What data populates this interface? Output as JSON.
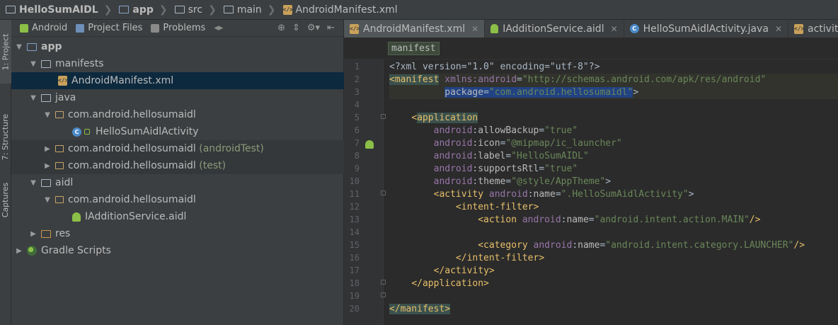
{
  "breadcrumb": [
    {
      "label": "HelloSumAIDL",
      "bold": true
    },
    {
      "label": "app",
      "bold": true
    },
    {
      "label": "src",
      "bold": false
    },
    {
      "label": "main",
      "bold": false
    },
    {
      "label": "AndroidManifest.xml",
      "bold": false
    }
  ],
  "toolstrip": {
    "project_tab": "1: Project",
    "structure_tab": "7: Structure",
    "captures_tab": "Captures"
  },
  "project_toolbar": {
    "android": "Android",
    "project_files": "Project Files",
    "problems": "Problems"
  },
  "tree": [
    {
      "label": "app",
      "suffix": ""
    },
    {
      "label": "manifests",
      "suffix": ""
    },
    {
      "label": "AndroidManifest.xml",
      "suffix": ""
    },
    {
      "label": "java",
      "suffix": ""
    },
    {
      "label": "com.android.hellosumaidl",
      "suffix": ""
    },
    {
      "label": "HelloSumAidlActivity",
      "suffix": ""
    },
    {
      "label": "com.android.hellosumaidl",
      "suffix": "(androidTest)"
    },
    {
      "label": "com.android.hellosumaidl",
      "suffix": "(test)"
    },
    {
      "label": "aidl",
      "suffix": ""
    },
    {
      "label": "com.android.hellosumaidl",
      "suffix": ""
    },
    {
      "label": "IAdditionService.aidl",
      "suffix": ""
    },
    {
      "label": "res",
      "suffix": ""
    },
    {
      "label": "Gradle Scripts",
      "suffix": ""
    }
  ],
  "editor_tabs": [
    {
      "label": "AndroidManifest.xml",
      "active": true
    },
    {
      "label": "IAdditionService.aidl",
      "active": false
    },
    {
      "label": "HelloSumAidlActivity.java",
      "active": false
    },
    {
      "label": "activity_hello",
      "active": false
    }
  ],
  "xml_breadcrumb": "manifest",
  "code": {
    "line_numbers": [
      "1",
      "2",
      "3",
      "4",
      "5",
      "6",
      "7",
      "8",
      "9",
      "10",
      "11",
      "12",
      "13",
      "14",
      "15",
      "16",
      "17",
      "18",
      "19",
      "20"
    ],
    "l1": "<?xml version=\"1.0\" encoding=\"utf-8\"?>",
    "l2_tag": "<manifest",
    "l2_ns": "xmlns:android",
    "l2_val": "\"http://schemas.android.com/apk/res/android\"",
    "l3_attr": "package",
    "l3_val": "\"com.android.hellosumaidl\"",
    "l5_tag": "application",
    "l6_attr": "allowBackup",
    "l6_val": "\"true\"",
    "l7_attr": "icon",
    "l7_val": "\"@mipmap/ic_launcher\"",
    "l8_attr": "label",
    "l8_val": "\"HelloSumAIDL\"",
    "l9_attr": "supportsRtl",
    "l9_val": "\"true\"",
    "l10_attr": "theme",
    "l10_val": "\"@style/AppTheme\"",
    "l11_tag": "<activity",
    "l11_attr": "name",
    "l11_val": "\".HelloSumAidlActivity\"",
    "l12_tag": "<intent-filter>",
    "l13_tag": "<action",
    "l13_attr": "name",
    "l13_val": "\"android.intent.action.MAIN\"",
    "l15_tag": "<category",
    "l15_attr": "name",
    "l15_val": "\"android.intent.category.LAUNCHER\"",
    "l16_tag": "</intent-filter>",
    "l17_tag": "</activity>",
    "l18_tag": "</application>",
    "l20_tag": "</manifest>",
    "ns": "android"
  }
}
